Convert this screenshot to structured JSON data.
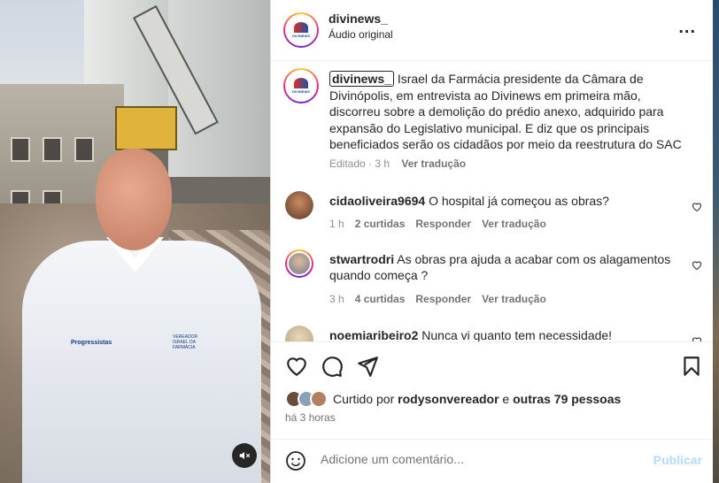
{
  "post": {
    "username": "divinews_",
    "audio": "Áudio original",
    "more_label": "..."
  },
  "media": {
    "badge_text": "VEREADOR ISRAEL DA FARMÁCIA",
    "party_text": "Progressistas",
    "mute_icon": "speaker-muted-icon"
  },
  "caption": {
    "username": "divinews_",
    "text": "Israel da Farmácia presidente da Câmara de Divinópolis, em entrevista ao Divinews em primeira mão, discorreu sobre a demolição do prédio anexo, adquirido para expansão do Legislativo municipal. E diz que os principais beneficiados serão os cidadãos por meio da reestrutura do SAC",
    "edited": "Editado · 3 h",
    "translate": "Ver tradução"
  },
  "comments": [
    {
      "username": "cidaoliveira9694",
      "text": "O hospital já começou as obras?",
      "time": "1 h",
      "likes": "2 curtidas",
      "reply": "Responder",
      "translate": "Ver tradução"
    },
    {
      "username": "stwartrodri",
      "text": "As obras pra ajuda a acabar com os alagamentos quando começa ?",
      "time": "3 h",
      "likes": "4 curtidas",
      "reply": "Responder",
      "translate": "Ver tradução"
    },
    {
      "username": "noemiaribeiro2",
      "text": "Nunca vi quanto tem necessidade!"
    }
  ],
  "likes": {
    "prefix": "Curtido por",
    "user": "rodysonvereador",
    "conj": "e",
    "others": "outras 79 pessoas"
  },
  "time_ago": "há 3 horas",
  "add_comment": {
    "placeholder": "Adicione um comentário...",
    "publish": "Publicar"
  },
  "colors": {
    "publish_disabled": "#b3dbff",
    "meta_gray": "#737373"
  }
}
